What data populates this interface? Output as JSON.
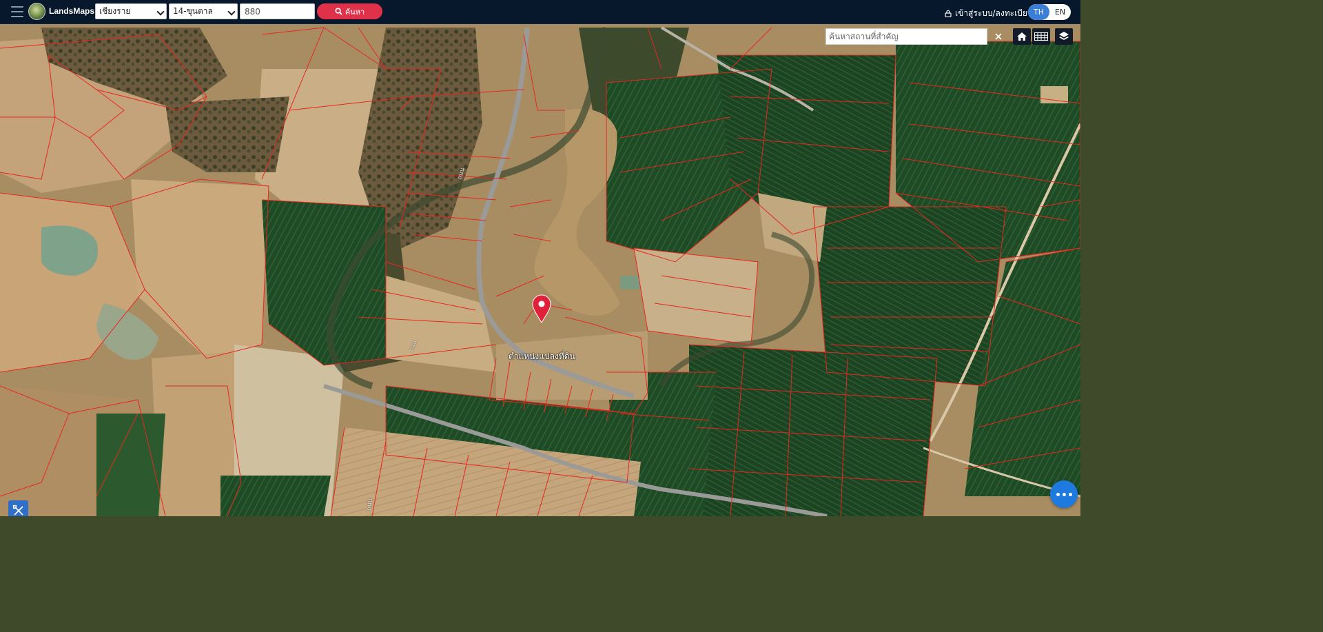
{
  "app": {
    "name": "LandsMaps"
  },
  "topbar": {
    "province": "เชียงราย",
    "district": "14-ขุนตาล",
    "parcel_number": "880",
    "search_label": "ค้นหา",
    "login_label": "เข้าสู่ระบบ/ลงทะเบียน",
    "lang_th": "TH",
    "lang_en": "EN",
    "active_lang": "TH"
  },
  "map": {
    "place_search_placeholder": "ค้นหาสถานที่สำคัญ",
    "marker_label": "ตำแหน่งแปลงที่ดิน",
    "parcel_line_color": "#e8261f",
    "marker_color": "#e0213a",
    "controls": [
      "close-icon",
      "home-icon",
      "grid-icon",
      "layers-icon"
    ]
  },
  "icons": {
    "tool": "measure-tool-icon",
    "chat": "chat-icon"
  }
}
